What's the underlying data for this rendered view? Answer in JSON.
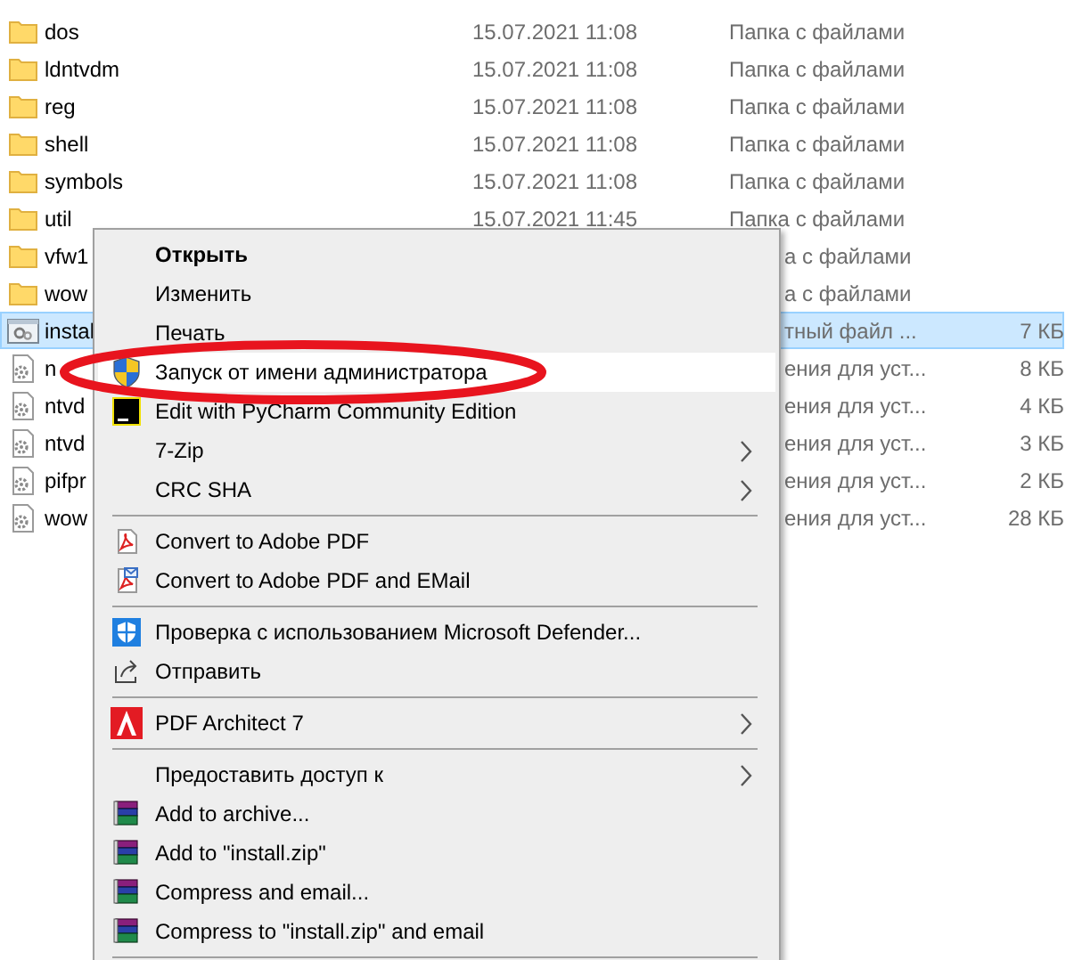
{
  "files": [
    {
      "name": "dos",
      "date": "15.07.2021 11:08",
      "type": "Папка с файлами",
      "kind": "folder",
      "selected": false
    },
    {
      "name": "ldntvdm",
      "date": "15.07.2021 11:08",
      "type": "Папка с файлами",
      "kind": "folder",
      "selected": false
    },
    {
      "name": "reg",
      "date": "15.07.2021 11:08",
      "type": "Папка с файлами",
      "kind": "folder",
      "selected": false
    },
    {
      "name": "shell",
      "date": "15.07.2021 11:08",
      "type": "Папка с файлами",
      "kind": "folder",
      "selected": false
    },
    {
      "name": "symbols",
      "date": "15.07.2021 11:08",
      "type": "Папка с файлами",
      "kind": "folder",
      "selected": false
    },
    {
      "name": "util",
      "date": "15.07.2021 11:45",
      "type": "Папка с файлами",
      "kind": "folder",
      "selected": false
    },
    {
      "name": "vfw1",
      "type": "а с файлами",
      "kind": "folder",
      "selected": false
    },
    {
      "name": "wow",
      "type": "а с файлами",
      "kind": "folder",
      "selected": false
    },
    {
      "name": "instal",
      "type": "тный файл ...",
      "size": "7 КБ",
      "kind": "setup",
      "selected": true
    },
    {
      "name": "n",
      "type": "ения для уст...",
      "size": "8 КБ",
      "kind": "config",
      "selected": false
    },
    {
      "name": "ntvd",
      "type": "ения для уст...",
      "size": "4 КБ",
      "kind": "config",
      "selected": false
    },
    {
      "name": "ntvd",
      "type": "ения для уст...",
      "size": "3 КБ",
      "kind": "config",
      "selected": false
    },
    {
      "name": "pifpr",
      "type": "ения для уст...",
      "size": "2 КБ",
      "kind": "config",
      "selected": false
    },
    {
      "name": "wow",
      "type": "ения для уст...",
      "size": "28 КБ",
      "kind": "config",
      "selected": false
    }
  ],
  "context_menu": [
    {
      "kind": "item",
      "label": "Открыть",
      "default": true,
      "submenu": false,
      "selected": false
    },
    {
      "kind": "item",
      "label": "Изменить",
      "default": false,
      "submenu": false,
      "selected": false
    },
    {
      "kind": "item",
      "label": "Печать",
      "default": false,
      "submenu": false,
      "selected": false
    },
    {
      "kind": "item",
      "label": "Запуск от имени администратора",
      "default": false,
      "submenu": false,
      "selected": true
    },
    {
      "kind": "item",
      "label": "Edit with PyCharm Community Edition",
      "default": false,
      "submenu": false,
      "selected": false
    },
    {
      "kind": "item",
      "label": "7-Zip",
      "default": false,
      "submenu": true,
      "selected": false
    },
    {
      "kind": "item",
      "label": "CRC SHA",
      "default": false,
      "submenu": true,
      "selected": false
    },
    {
      "kind": "separator"
    },
    {
      "kind": "item",
      "label": "Convert to Adobe PDF",
      "default": false,
      "submenu": false,
      "selected": false
    },
    {
      "kind": "item",
      "label": "Convert to Adobe PDF and EMail",
      "default": false,
      "submenu": false,
      "selected": false
    },
    {
      "kind": "separator"
    },
    {
      "kind": "item",
      "label": "Проверка с использованием Microsoft Defender...",
      "default": false,
      "submenu": false,
      "selected": false
    },
    {
      "kind": "item",
      "label": "Отправить",
      "default": false,
      "submenu": false,
      "selected": false
    },
    {
      "kind": "separator"
    },
    {
      "kind": "item",
      "label": "PDF Architect 7",
      "default": false,
      "submenu": true,
      "selected": false
    },
    {
      "kind": "separator"
    },
    {
      "kind": "item",
      "label": "Предоставить доступ к",
      "default": false,
      "submenu": true,
      "selected": false
    },
    {
      "kind": "item",
      "label": "Add to archive...",
      "default": false,
      "submenu": false,
      "selected": false
    },
    {
      "kind": "item",
      "label": "Add to \"install.zip\"",
      "default": false,
      "submenu": false,
      "selected": false
    },
    {
      "kind": "item",
      "label": "Compress and email...",
      "default": false,
      "submenu": false,
      "selected": false
    },
    {
      "kind": "item",
      "label": "Compress to \"install.zip\" and email",
      "default": false,
      "submenu": false,
      "selected": false
    },
    {
      "kind": "separator"
    }
  ]
}
